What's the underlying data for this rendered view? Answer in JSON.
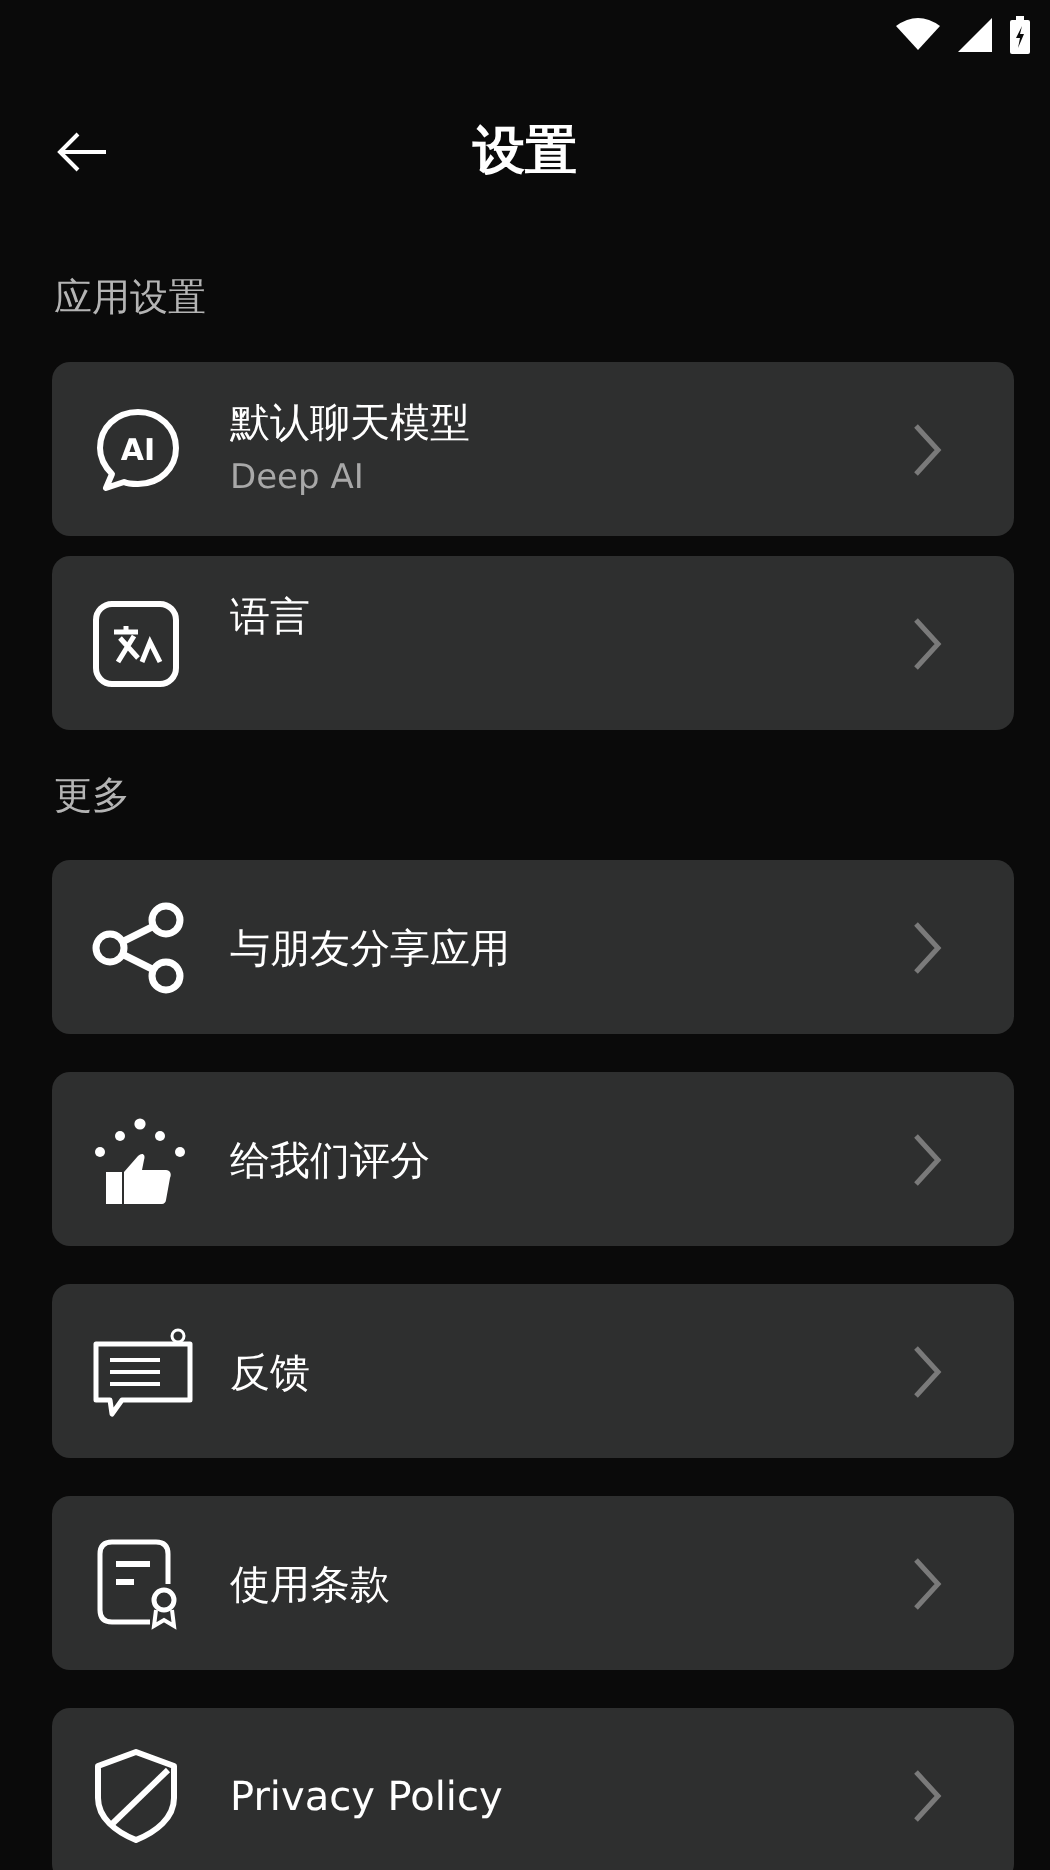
{
  "header": {
    "title": "设置"
  },
  "sections": [
    {
      "title": "应用设置",
      "items": [
        {
          "kind": "detail",
          "title": "默认聊天模型",
          "subtitle": "Deep AI",
          "icon_text": "AI"
        },
        {
          "kind": "detail",
          "title": "语言"
        }
      ]
    },
    {
      "title": "更多",
      "items": [
        {
          "kind": "link",
          "title": "与朋友分享应用"
        },
        {
          "kind": "link",
          "title": "给我们评分"
        },
        {
          "kind": "link",
          "title": "反馈"
        },
        {
          "kind": "link",
          "title": "使用条款"
        },
        {
          "kind": "link",
          "title": "Privacy Policy"
        }
      ]
    }
  ]
}
